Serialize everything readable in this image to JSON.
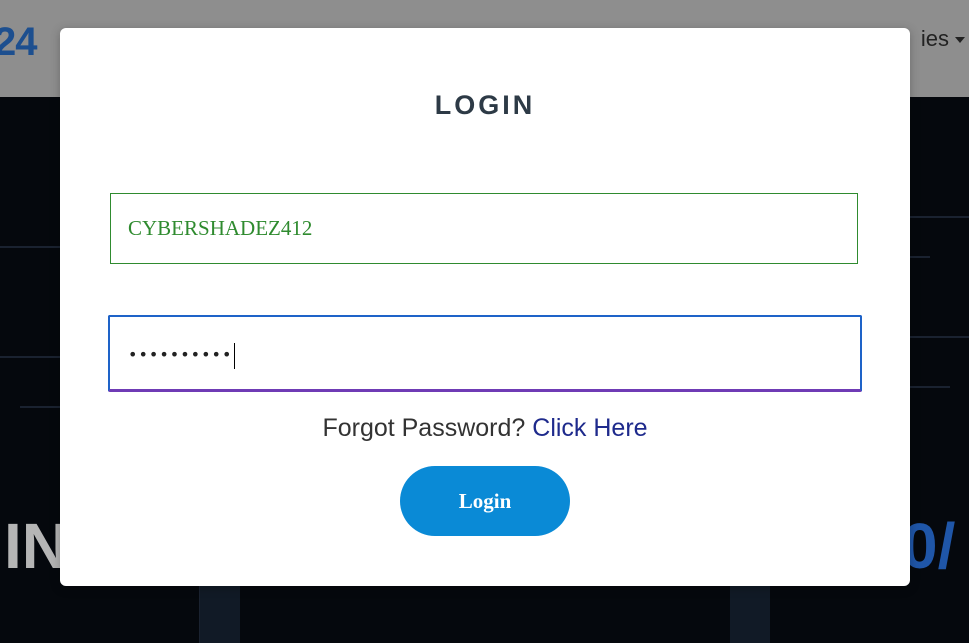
{
  "background": {
    "logo_text": "24",
    "nav_text": "ies",
    "hero_left_text": "IN",
    "hero_right_text": "0/"
  },
  "modal": {
    "title": "LOGIN",
    "username": {
      "value": "CYBERSHADEZ412"
    },
    "password": {
      "masked_value": "••••••••••"
    },
    "forgot_password": {
      "prefix": "Forgot Password?",
      "link_label": "Click Here"
    },
    "login_button": {
      "label": "Login"
    }
  },
  "colors": {
    "username_border": "#2f8b2f",
    "password_border": "#1e63c8",
    "button_bg": "#0a8ad6",
    "link": "#1e2a8c"
  }
}
